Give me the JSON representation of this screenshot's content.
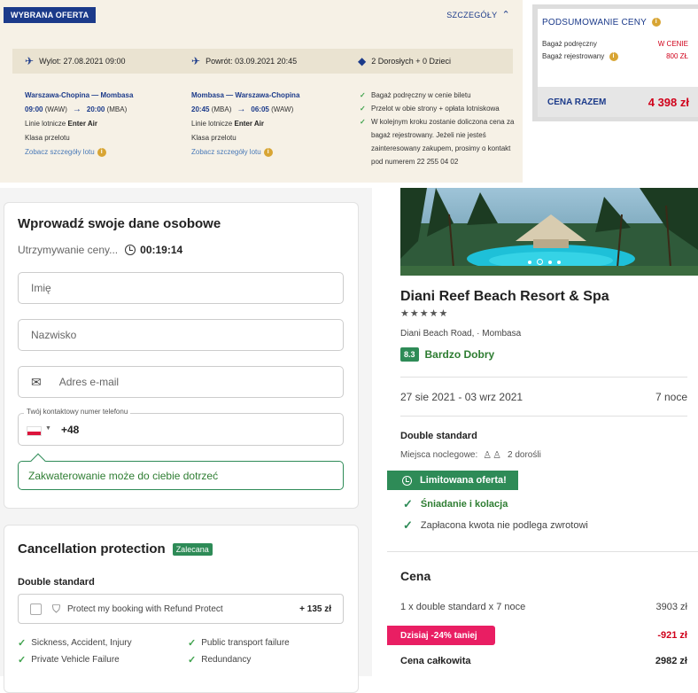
{
  "offer": {
    "badge": "WYBRANA OFERTA",
    "details": "SZCZEGÓŁY",
    "outbound_header": "Wylot: 27.08.2021 09:00",
    "return_header": "Powrót: 03.09.2021 20:45",
    "passengers": "2 Dorosłych + 0 Dzieci",
    "outbound": {
      "route": "Warszawa-Chopina — Mombasa",
      "dep_time": "09:00",
      "dep_code": "(WAW)",
      "arr_time": "20:00",
      "arr_code": "(MBA)",
      "airline_prefix": "Linie lotnicze",
      "airline": "Enter Air",
      "class": "Klasa przelotu",
      "link": "Zobacz szczegóły lotu"
    },
    "return": {
      "route": "Mombasa — Warszawa-Chopina",
      "dep_time": "20:45",
      "dep_code": "(MBA)",
      "arr_time": "06:05",
      "arr_code": "(WAW)",
      "airline_prefix": "Linie lotnicze",
      "airline": "Enter Air",
      "class": "Klasa przelotu",
      "link": "Zobacz szczegóły lotu"
    },
    "checks": [
      "Bagaż podręczny w cenie biletu",
      "Przelot w obie strony + opłata lotniskowa",
      "W kolejnym kroku zostanie doliczona cena za bagaż rejestrowany. Jeżeli nie jesteś zainteresowany zakupem, prosimy o kontakt pod numerem 22 255 04 02"
    ]
  },
  "summary": {
    "title": "PODSUMOWANIE CENY",
    "rows": [
      {
        "label": "Bagaż podręczny",
        "value": "W CENIE"
      },
      {
        "label": "Bagaż rejestrowany",
        "value": "800 ZŁ"
      }
    ],
    "total_label": "CENA RAZEM",
    "total_value": "4 398 zł"
  },
  "form": {
    "title": "Wprowadź swoje dane osobowe",
    "hold_label": "Utrzymywanie ceny...",
    "hold_time": "00:19:14",
    "first_name_placeholder": "Imię",
    "last_name_placeholder": "Nazwisko",
    "email_placeholder": "Adres e-mail",
    "phone_label": "Twój kontaktowy numer telefonu",
    "phone_code": "+48",
    "tip": "Zakwaterowanie może do ciebie dotrzeć"
  },
  "cancel": {
    "title": "Cancellation protection",
    "badge": "Zalecana",
    "room": "Double standard",
    "option": "Protect my booking with Refund Protect",
    "option_price": "+ 135 zł",
    "features": [
      "Sickness, Accident, Injury",
      "Public transport failure",
      "Private Vehicle Failure",
      "Redundancy"
    ]
  },
  "hotel": {
    "name": "Diani Reef Beach Resort & Spa",
    "stars": "★★★★★",
    "address": "Diani Beach Road, · Mombasa",
    "score": "8.3",
    "score_text": "Bardzo Dobry",
    "dates": "27 sie 2021 - 03 wrz 2021",
    "nights": "7 noce",
    "room": "Double standard",
    "occupancy_label": "Miejsca noclegowe:",
    "occupancy": "2 dorośli",
    "limited": "Limitowana oferta!",
    "perks": [
      "Śniadanie i kolacja",
      "Zapłacona kwota nie podlega zwrotowi"
    ],
    "price_title": "Cena",
    "price_line": "1 x double standard x 7 noce",
    "price_line_value": "3903 zł",
    "discount": "Dzisiaj -24% taniej",
    "discount_value": "-921 zł",
    "total_label": "Cena całkowita",
    "total_value": "2982 zł"
  },
  "colors": {
    "brand_blue": "#1b3a8a",
    "accent_green": "#2e8b57",
    "price_red": "#d0021b",
    "discount_pink": "#e91e63"
  }
}
